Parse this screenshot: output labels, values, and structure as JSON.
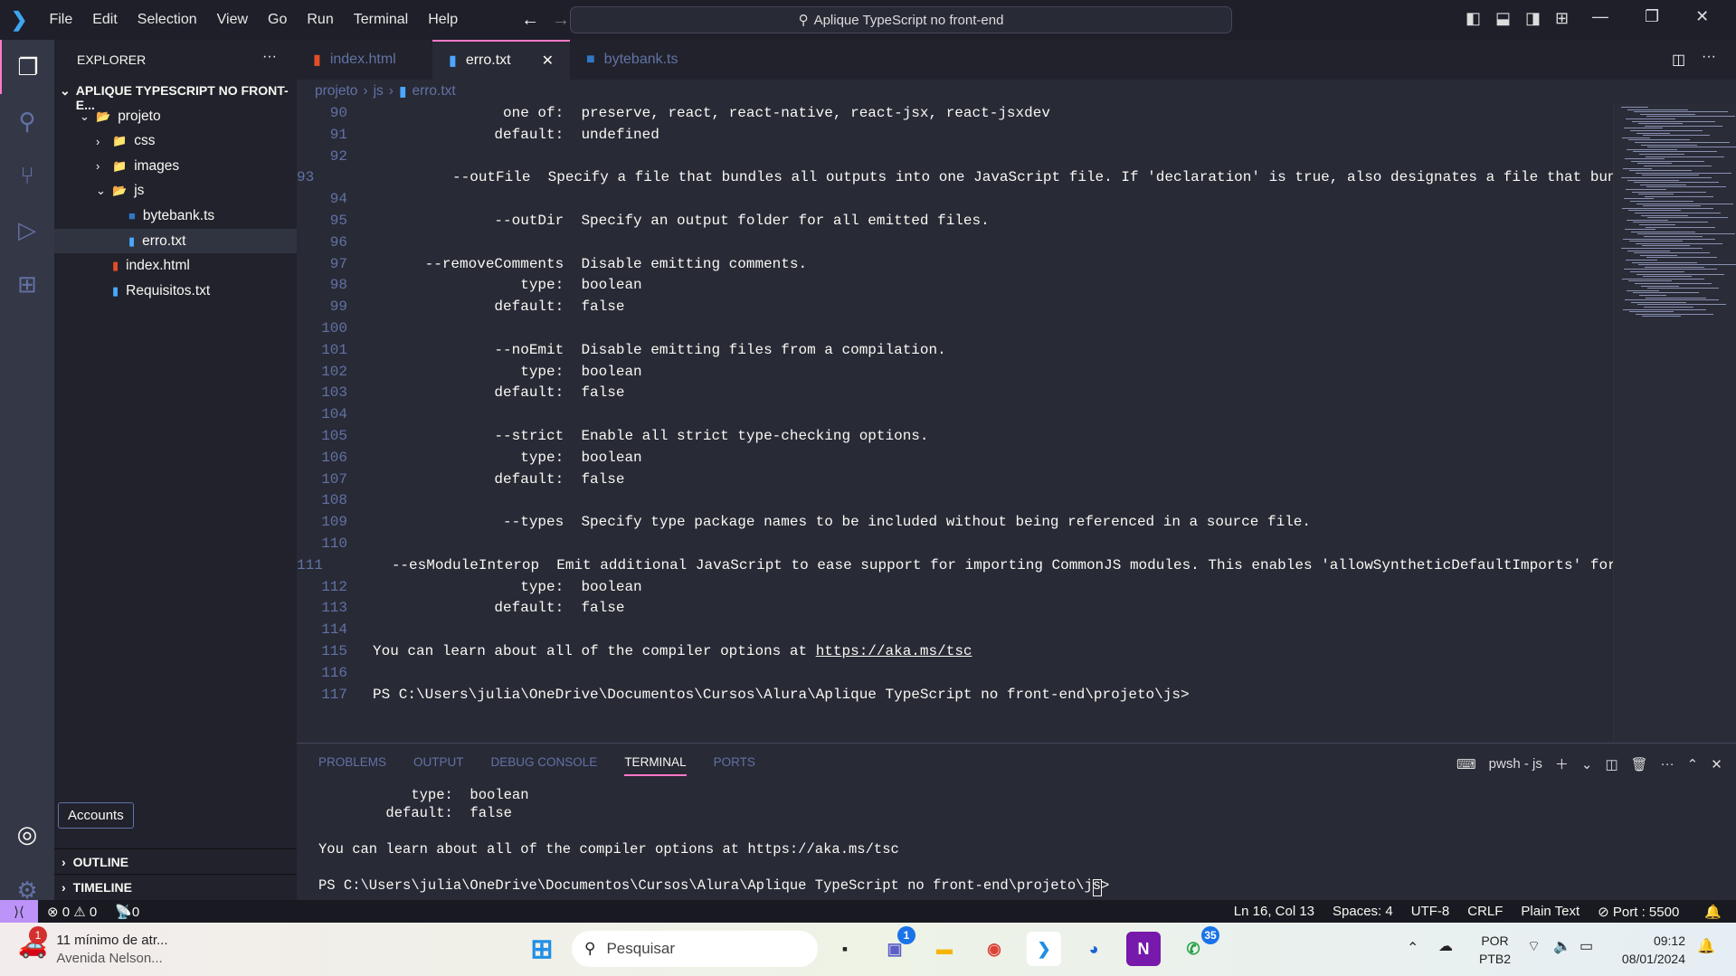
{
  "titlebar": {
    "menus": [
      "File",
      "Edit",
      "Selection",
      "View",
      "Go",
      "Run",
      "Terminal",
      "Help"
    ],
    "search": "Aplique TypeScript no front-end"
  },
  "sidebar": {
    "title": "EXPLORER",
    "root": "APLIQUE TYPESCRIPT NO FRONT-E...",
    "items": [
      {
        "label": "projeto",
        "type": "folder-open",
        "depth": 1
      },
      {
        "label": "css",
        "type": "folder",
        "depth": 2
      },
      {
        "label": "images",
        "type": "folder",
        "depth": 2
      },
      {
        "label": "js",
        "type": "folder-open",
        "depth": 2
      },
      {
        "label": "bytebank.ts",
        "type": "ts",
        "depth": 3
      },
      {
        "label": "erro.txt",
        "type": "txt",
        "depth": 3,
        "selected": true
      },
      {
        "label": "index.html",
        "type": "html",
        "depth": 2
      },
      {
        "label": "Requisitos.txt",
        "type": "txt",
        "depth": 2
      }
    ],
    "outline": "OUTLINE",
    "timeline": "TIMELINE",
    "accounts_tooltip": "Accounts"
  },
  "tabs": [
    {
      "label": "index.html",
      "icon": "html-icon"
    },
    {
      "label": "erro.txt",
      "icon": "txt-icon",
      "active": true
    },
    {
      "label": "bytebank.ts",
      "icon": "ts-icon"
    }
  ],
  "breadcrumb": [
    "projeto",
    "js",
    "erro.txt"
  ],
  "editor": {
    "lines": [
      {
        "n": "90",
        "t": "               one of:  preserve, react, react-native, react-jsx, react-jsxdev"
      },
      {
        "n": "91",
        "t": "              default:  undefined"
      },
      {
        "n": "92",
        "t": ""
      },
      {
        "n": "93",
        "t": "             --outFile  Specify a file that bundles all outputs into one JavaScript file. If 'declaration' is true, also designates a file that bundles all .d.ts output."
      },
      {
        "n": "94",
        "t": ""
      },
      {
        "n": "95",
        "t": "              --outDir  Specify an output folder for all emitted files."
      },
      {
        "n": "96",
        "t": ""
      },
      {
        "n": "97",
        "t": "      --removeComments  Disable emitting comments."
      },
      {
        "n": "98",
        "t": "                 type:  boolean"
      },
      {
        "n": "99",
        "t": "              default:  false"
      },
      {
        "n": "100",
        "t": ""
      },
      {
        "n": "101",
        "t": "              --noEmit  Disable emitting files from a compilation."
      },
      {
        "n": "102",
        "t": "                 type:  boolean"
      },
      {
        "n": "103",
        "t": "              default:  false"
      },
      {
        "n": "104",
        "t": ""
      },
      {
        "n": "105",
        "t": "              --strict  Enable all strict type-checking options."
      },
      {
        "n": "106",
        "t": "                 type:  boolean"
      },
      {
        "n": "107",
        "t": "              default:  false"
      },
      {
        "n": "108",
        "t": ""
      },
      {
        "n": "109",
        "t": "               --types  Specify type package names to be included without being referenced in a source file."
      },
      {
        "n": "110",
        "t": ""
      },
      {
        "n": "111",
        "t": "     --esModuleInterop  Emit additional JavaScript to ease support for importing CommonJS modules. This enables 'allowSyntheticDefaultImports' for type compatibility."
      },
      {
        "n": "112",
        "t": "                 type:  boolean"
      },
      {
        "n": "113",
        "t": "              default:  false"
      },
      {
        "n": "114",
        "t": ""
      },
      {
        "n": "115",
        "t": "You can learn about all of the compiler options at ",
        "link": "https://aka.ms/tsc"
      },
      {
        "n": "116",
        "t": ""
      },
      {
        "n": "117",
        "t": "PS C:\\Users\\julia\\OneDrive\\Documentos\\Cursos\\Alura\\Aplique TypeScript no front-end\\projeto\\js>"
      }
    ]
  },
  "panel": {
    "tabs": [
      "PROBLEMS",
      "OUTPUT",
      "DEBUG CONSOLE",
      "TERMINAL",
      "PORTS"
    ],
    "active": "TERMINAL",
    "shell": "pwsh - js",
    "lines": [
      "           type:  boolean",
      "        default:  false",
      "",
      "You can learn about all of the compiler options at https://aka.ms/tsc",
      "",
      "PS C:\\Users\\julia\\OneDrive\\Documentos\\Cursos\\Alura\\Aplique TypeScript no front-end\\projeto\\js> "
    ]
  },
  "statusbar": {
    "errors": "0",
    "warnings": "0",
    "ports": "0",
    "position": "Ln 16, Col 13",
    "spaces": "Spaces: 4",
    "encoding": "UTF-8",
    "eol": "CRLF",
    "language": "Plain Text",
    "live_server": "Port : 5500"
  },
  "taskbar": {
    "weather_title": "11 mínimo de atr...",
    "weather_sub": "Avenida Nelson...",
    "weather_badge": "1",
    "search": "Pesquisar",
    "teams_badge": "1",
    "whatsapp_badge": "35",
    "lang1": "POR",
    "lang2": "PTB2",
    "time": "09:12",
    "date": "08/01/2024"
  },
  "colors": {
    "accent": "#ff79c6",
    "remote": "#bd93f9",
    "editor_bg": "#282a36"
  }
}
